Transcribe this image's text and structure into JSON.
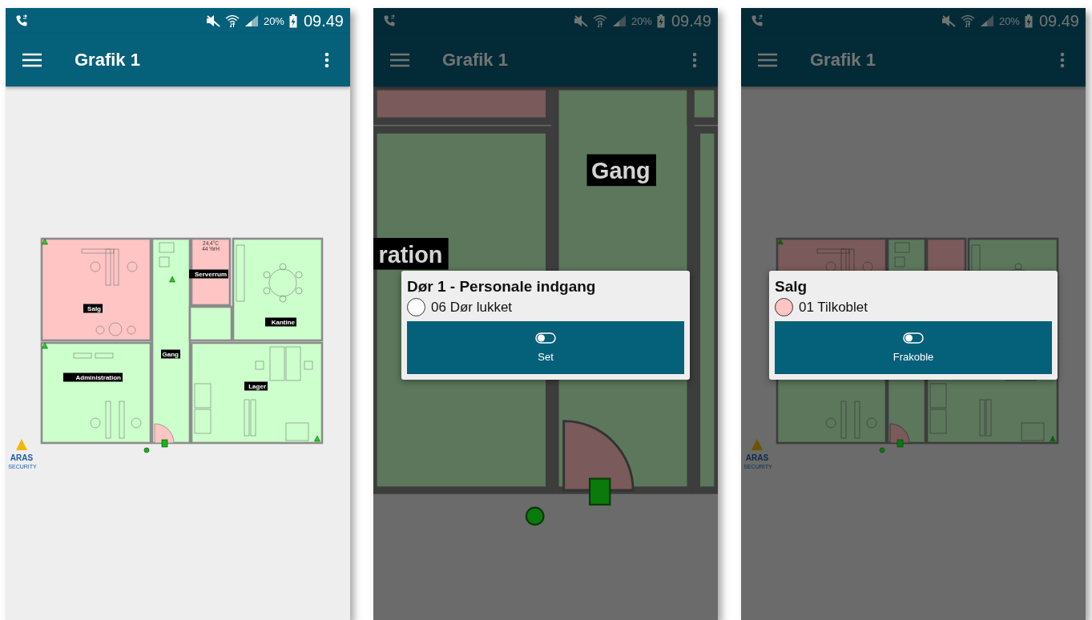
{
  "phones": [
    {
      "status_bar": {
        "battery": "20%",
        "time": "09.49"
      },
      "app_bar": {
        "title": "Grafik 1"
      },
      "plan": {
        "zoomed": false,
        "rooms": [
          {
            "name": "Salg",
            "color": "#ffc4c4"
          },
          {
            "name": "Administration",
            "color": "#ccffcc"
          },
          {
            "name": "Gang",
            "color": "#ccffcc"
          },
          {
            "name": "Serverrum",
            "color": "#ffc4c4",
            "readings": [
              "24,4°C",
              "44 %rH"
            ]
          },
          {
            "name": "Kantine",
            "color": "#ccffcc"
          },
          {
            "name": "Lager",
            "color": "#ccffcc"
          }
        ],
        "logo": {
          "name": "ARAS",
          "tagline": "SECURITY"
        }
      }
    },
    {
      "status_bar": {
        "battery": "20%",
        "time": "09.49"
      },
      "app_bar": {
        "title": "Grafik 1"
      },
      "plan": {
        "zoomed": true,
        "rooms": [
          {
            "color": "#7a5a5a"
          },
          {
            "name": "ration",
            "color": "#5c775c"
          },
          {
            "name": "Gang",
            "color": "#5c775c"
          },
          {
            "color": "#5c775c"
          }
        ]
      },
      "dialog": {
        "title": "Dør 1 - Personale indgang",
        "status": {
          "text": "06 Dør lukket",
          "color": "#ffffff"
        },
        "button": "Set"
      }
    },
    {
      "status_bar": {
        "battery": "20%",
        "time": "09.49"
      },
      "app_bar": {
        "title": "Grafik 1"
      },
      "plan": {
        "zoomed": false,
        "rooms": [
          {
            "color": "#7a5a5a"
          },
          {
            "color": "#5c775c"
          },
          {
            "color": "#5c775c"
          },
          {
            "color": "#7a5a5a"
          },
          {
            "color": "#5c775c"
          },
          {
            "color": "#5c775c"
          }
        ],
        "logo": {
          "name": "ARAS",
          "tagline": "SECURITY"
        }
      },
      "dialog": {
        "title": "Salg",
        "status": {
          "text": "01 Tilkoblet",
          "color": "#ffc4c4"
        },
        "button": "Frakoble"
      }
    }
  ]
}
